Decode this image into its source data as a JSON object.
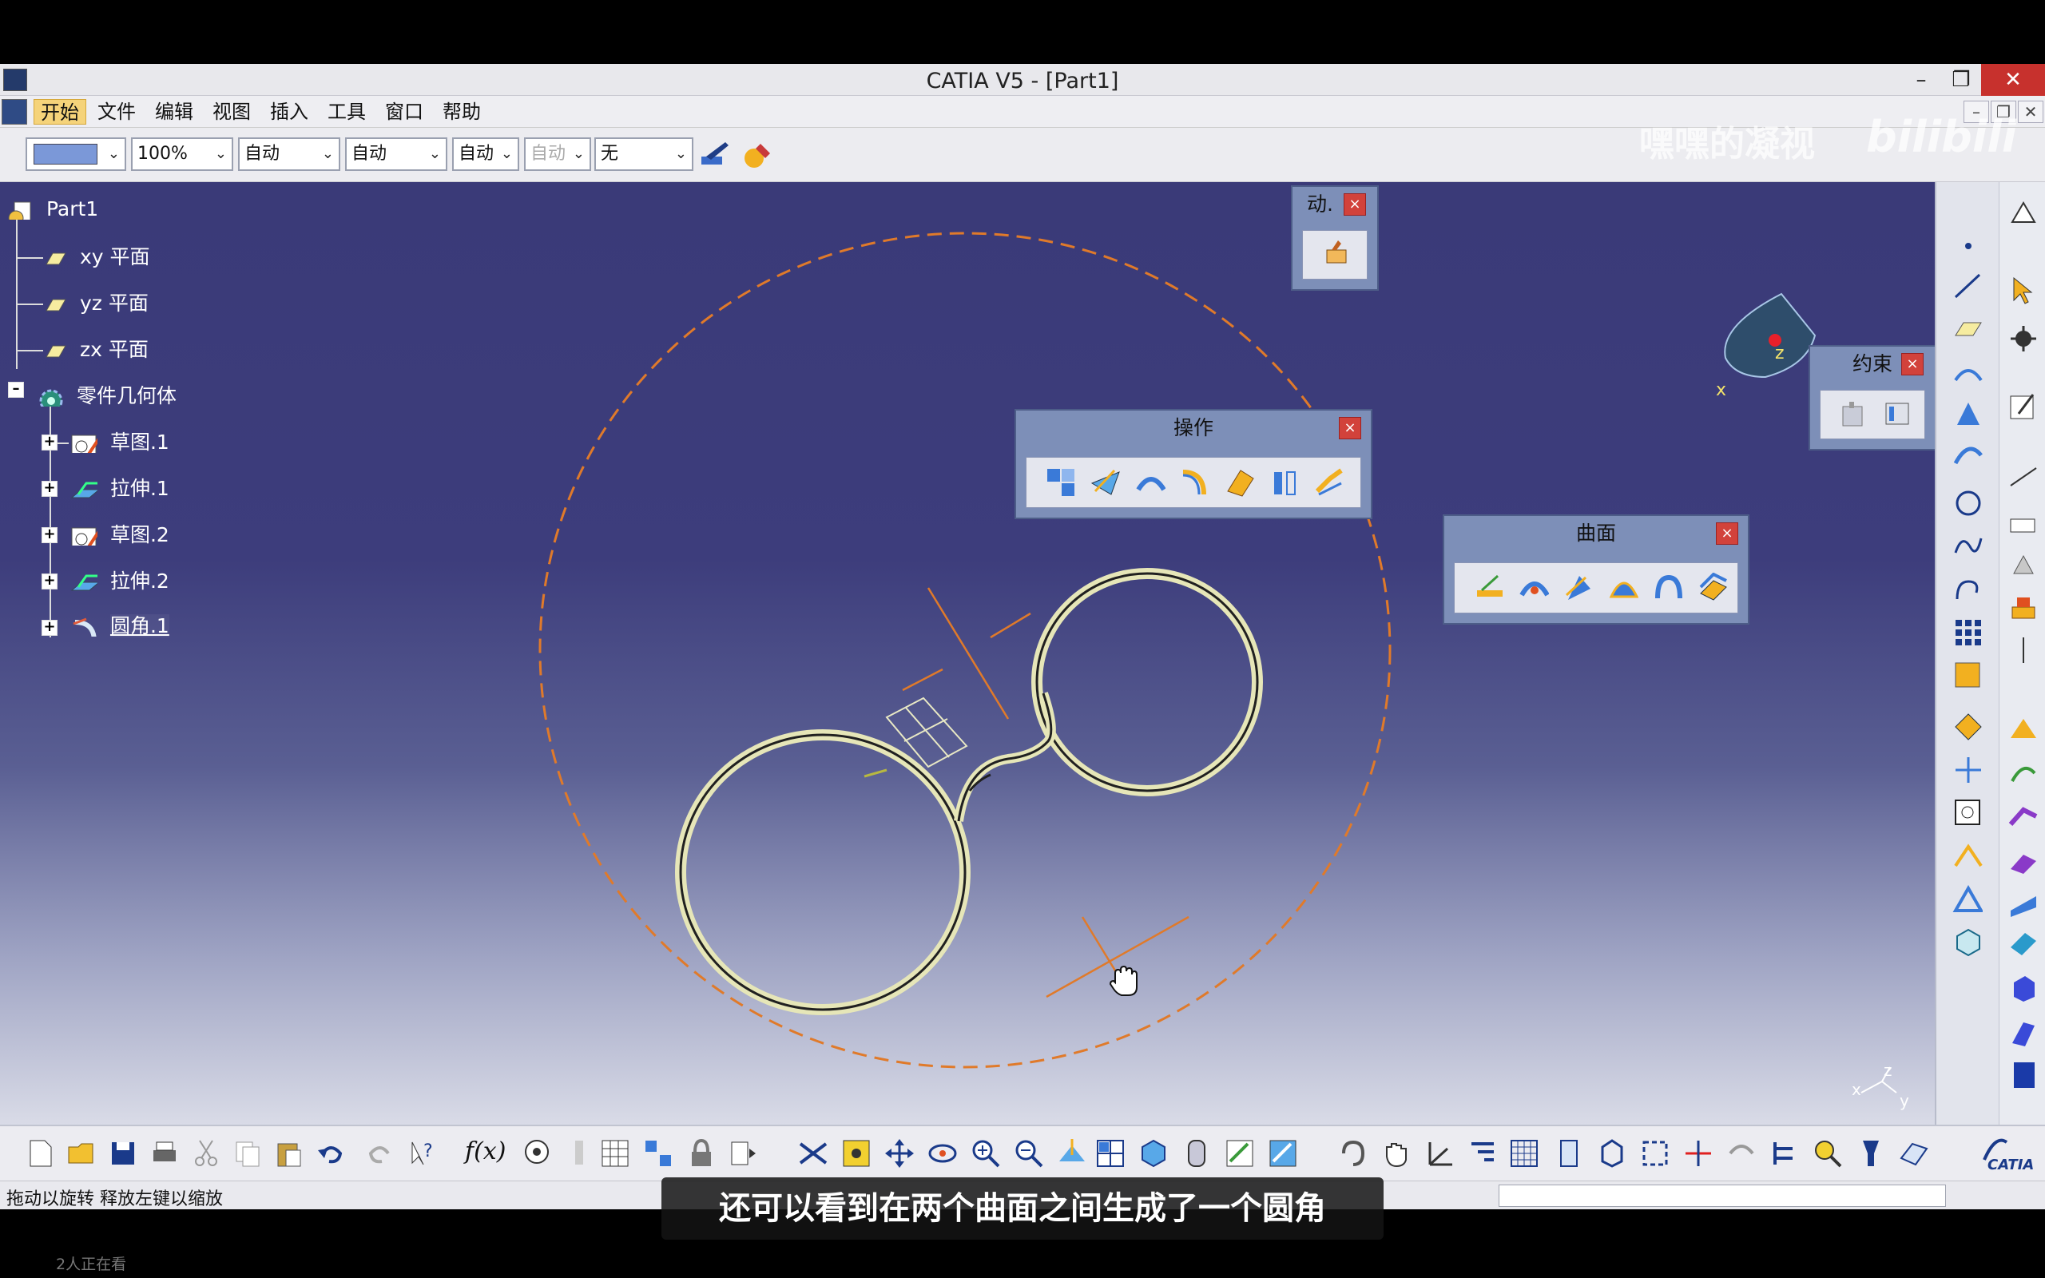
{
  "window": {
    "title": "CATIA V5 - [Part1]",
    "minimize": "–",
    "restore": "❐",
    "close": "✕"
  },
  "menu": {
    "items": [
      "开始",
      "文件",
      "编辑",
      "视图",
      "插入",
      "工具",
      "窗口",
      "帮助"
    ]
  },
  "mdi": {
    "minimize": "–",
    "restore": "❐",
    "close": "✕"
  },
  "props": {
    "zoom": "100%",
    "combo_a": "自动",
    "combo_b": "自动",
    "combo_c": "自动",
    "combo_d": "自动",
    "combo_e": "无"
  },
  "watermark": {
    "text": "嘿嘿的凝视",
    "logo": "bilibili"
  },
  "tree": {
    "root": "Part1",
    "planes": [
      "xy 平面",
      "yz 平面",
      "zx 平面"
    ],
    "body": "零件几何体",
    "features": [
      "草图.1",
      "拉伸.1",
      "草图.2",
      "拉伸.2",
      "圆角.1"
    ],
    "selected": "圆角.1"
  },
  "toolbars": {
    "anim": {
      "title": "动.",
      "close": "×"
    },
    "ops": {
      "title": "操作",
      "close": "×"
    },
    "surface": {
      "title": "曲面",
      "close": "×"
    },
    "constraint": {
      "title": "约束",
      "close": "×"
    }
  },
  "compass": {
    "x": "x",
    "z": "z"
  },
  "axis_triad": {
    "x": "x",
    "y": "y",
    "z": "z"
  },
  "brand": "CATIA",
  "status": {
    "text": "拖动以旋转   释放左键以缩放"
  },
  "subtitle": "还可以看到在两个曲面之间生成了一个圆角",
  "viewers": "2人正在看",
  "colors": {
    "background_top": "#3a3a78",
    "background_bottom": "#d9dbe7",
    "construction": "#e07a2a",
    "surface_edge": "#d8d8a8"
  }
}
